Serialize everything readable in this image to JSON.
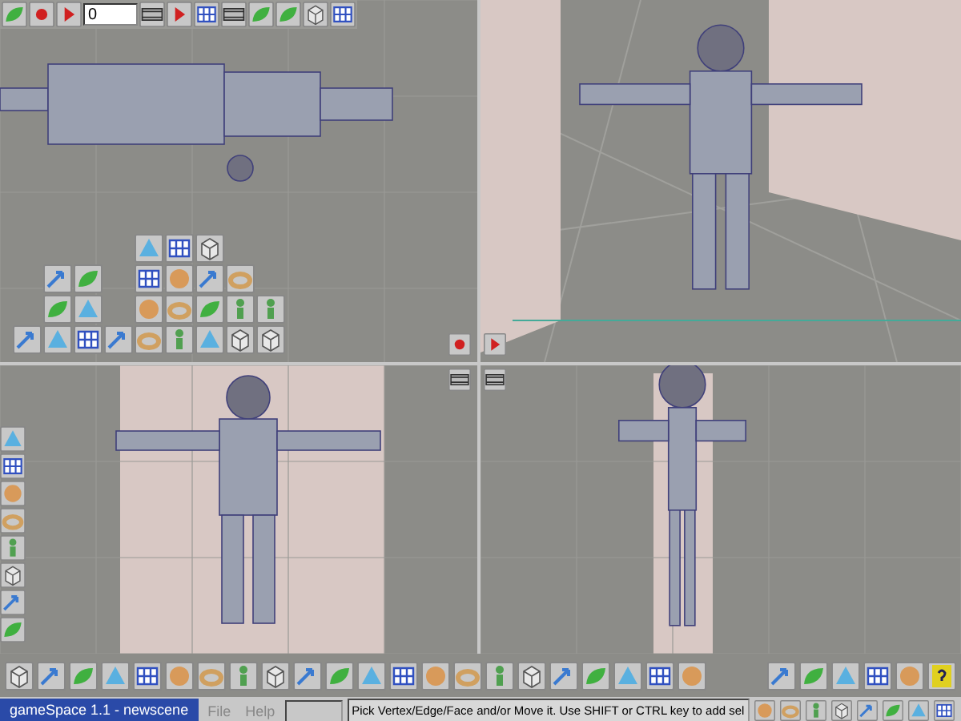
{
  "window": {
    "title": "gameSpace 1.1 - newscene"
  },
  "timeline": {
    "frame": "0"
  },
  "menu": [
    {
      "label": "File"
    },
    {
      "label": "Help"
    }
  ],
  "status_bar": {
    "text": "Pick Vertex/Edge/Face and/or Move it. Use SHIFT or CTRL key to add sel"
  }
}
